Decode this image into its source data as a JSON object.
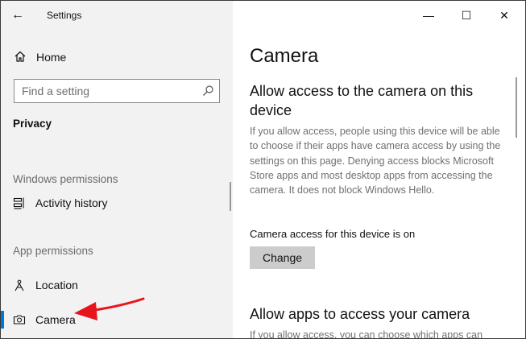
{
  "window": {
    "app_title": "Settings",
    "controls": {
      "back": "←",
      "minimize": "—",
      "maximize": "☐",
      "close": "✕"
    }
  },
  "sidebar": {
    "home_label": "Home",
    "search": {
      "placeholder": "Find a setting",
      "value": ""
    },
    "section": "Privacy",
    "groups": [
      {
        "label": "Windows permissions",
        "items": [
          {
            "label": "Activity history",
            "icon": "activity-history-icon"
          }
        ]
      },
      {
        "label": "App permissions",
        "items": [
          {
            "label": "Location",
            "icon": "location-icon"
          },
          {
            "label": "Camera",
            "icon": "camera-icon",
            "selected": true
          }
        ]
      }
    ]
  },
  "main": {
    "title": "Camera",
    "section1": {
      "heading": "Allow access to the camera on this device",
      "description": "If you allow access, people using this device will be able to choose if their apps have camera access by using the settings on this page. Denying access blocks Microsoft Store apps and most desktop apps from accessing the camera. It does not block Windows Hello.",
      "status": "Camera access for this device is on",
      "button": "Change"
    },
    "section2": {
      "heading": "Allow apps to access your camera",
      "description": "If you allow access, you can choose which apps can"
    }
  },
  "colors": {
    "accent": "#0078d7",
    "annotation_arrow": "#e8141c",
    "sidebar_bg": "#f2f2f2"
  }
}
